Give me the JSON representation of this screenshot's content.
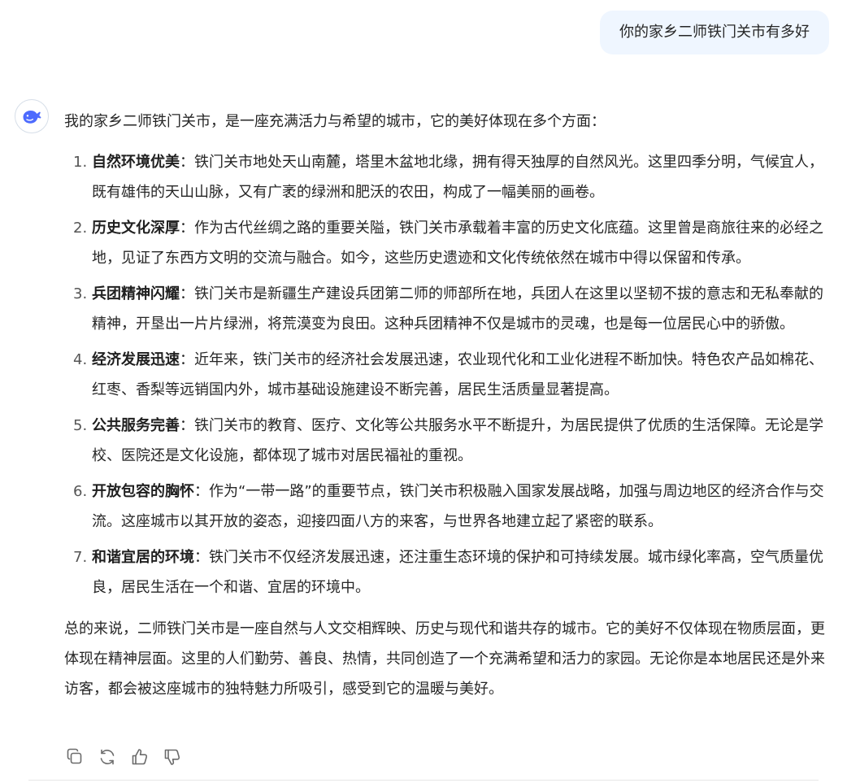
{
  "user_message": "你的家乡二师铁门关市有多好",
  "assistant": {
    "intro": "我的家乡二师铁门关市，是一座充满活力与希望的城市，它的美好体现在多个方面：",
    "points": [
      {
        "num": "1.",
        "title": "自然环境优美",
        "text": "：铁门关市地处天山南麓，塔里木盆地北缘，拥有得天独厚的自然风光。这里四季分明，气候宜人，既有雄伟的天山山脉，又有广袤的绿洲和肥沃的农田，构成了一幅美丽的画卷。"
      },
      {
        "num": "2.",
        "title": "历史文化深厚",
        "text": "：作为古代丝绸之路的重要关隘，铁门关市承载着丰富的历史文化底蕴。这里曾是商旅往来的必经之地，见证了东西方文明的交流与融合。如今，这些历史遗迹和文化传统依然在城市中得以保留和传承。"
      },
      {
        "num": "3.",
        "title": "兵团精神闪耀",
        "text": "：铁门关市是新疆生产建设兵团第二师的师部所在地，兵团人在这里以坚韧不拔的意志和无私奉献的精神，开垦出一片片绿洲，将荒漠变为良田。这种兵团精神不仅是城市的灵魂，也是每一位居民心中的骄傲。"
      },
      {
        "num": "4.",
        "title": "经济发展迅速",
        "text": "：近年来，铁门关市的经济社会发展迅速，农业现代化和工业化进程不断加快。特色农产品如棉花、红枣、香梨等远销国内外，城市基础设施建设不断完善，居民生活质量显著提高。"
      },
      {
        "num": "5.",
        "title": "公共服务完善",
        "text": "：铁门关市的教育、医疗、文化等公共服务水平不断提升，为居民提供了优质的生活保障。无论是学校、医院还是文化设施，都体现了城市对居民福祉的重视。"
      },
      {
        "num": "6.",
        "title": "开放包容的胸怀",
        "text": "：作为“一带一路”的重要节点，铁门关市积极融入国家发展战略，加强与周边地区的经济合作与交流。这座城市以其开放的姿态，迎接四面八方的来客，与世界各地建立起了紧密的联系。"
      },
      {
        "num": "7.",
        "title": "和谐宜居的环境",
        "text": "：铁门关市不仅经济发展迅速，还注重生态环境的保护和可持续发展。城市绿化率高，空气质量优良，居民生活在一个和谐、宜居的环境中。"
      }
    ],
    "summary": "总的来说，二师铁门关市是一座自然与人文交相辉映、历史与现代和谐共存的城市。它的美好不仅体现在物质层面，更体现在精神层面。这里的人们勤劳、善良、热情，共同创造了一个充满希望和活力的家园。无论你是本地居民还是外来访客，都会被这座城市的独特魅力所吸引，感受到它的温暖与美好。"
  },
  "actions": [
    {
      "icon": "copy-icon"
    },
    {
      "icon": "regenerate-icon"
    },
    {
      "icon": "thumbs-up-icon"
    },
    {
      "icon": "thumbs-down-icon"
    }
  ],
  "colors": {
    "brand": "#4d6bfe",
    "user_bubble": "#eff6ff",
    "icon_gray": "#6b6b6b"
  }
}
